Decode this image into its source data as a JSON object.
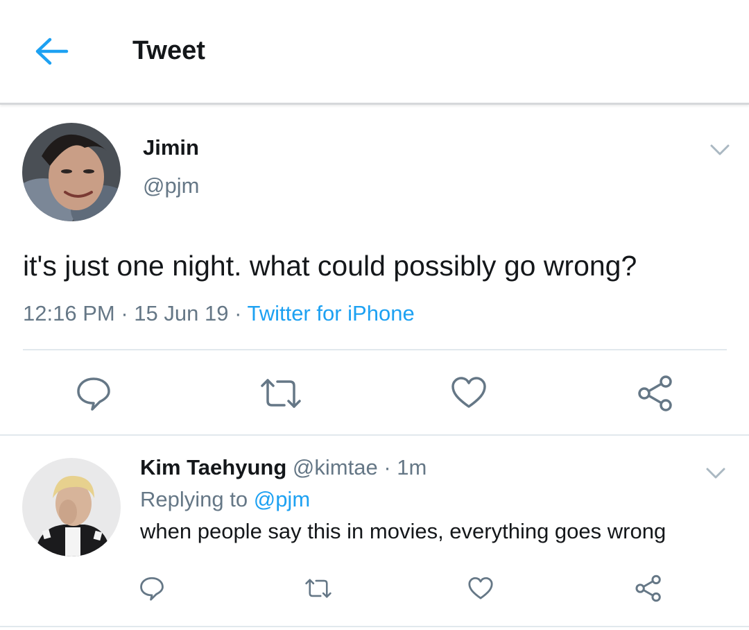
{
  "header": {
    "title": "Tweet",
    "back_icon": "arrow-left-icon"
  },
  "tweet": {
    "name": "Jimin",
    "handle": "@pjm",
    "text": "it's just one night. what could possibly go wrong?",
    "time": "12:16 PM",
    "date": "15 Jun 19",
    "source": "Twitter for iPhone",
    "sep": "·",
    "actions": [
      "reply-icon",
      "retweet-icon",
      "like-icon",
      "share-icon"
    ]
  },
  "reply": {
    "name": "Kim Taehyung",
    "handle": "@kimtae",
    "sep": "·",
    "time": "1m",
    "replying_prefix": "Replying to",
    "replying_to": "@pjm",
    "text": "when people say this in movies, everything goes wrong",
    "actions": [
      "reply-icon",
      "retweet-icon",
      "like-icon",
      "share-icon"
    ]
  },
  "colors": {
    "accent": "#1da1f2",
    "text": "#14171a",
    "muted": "#657786",
    "icon": "#657786",
    "divider": "#e1e8ed"
  }
}
